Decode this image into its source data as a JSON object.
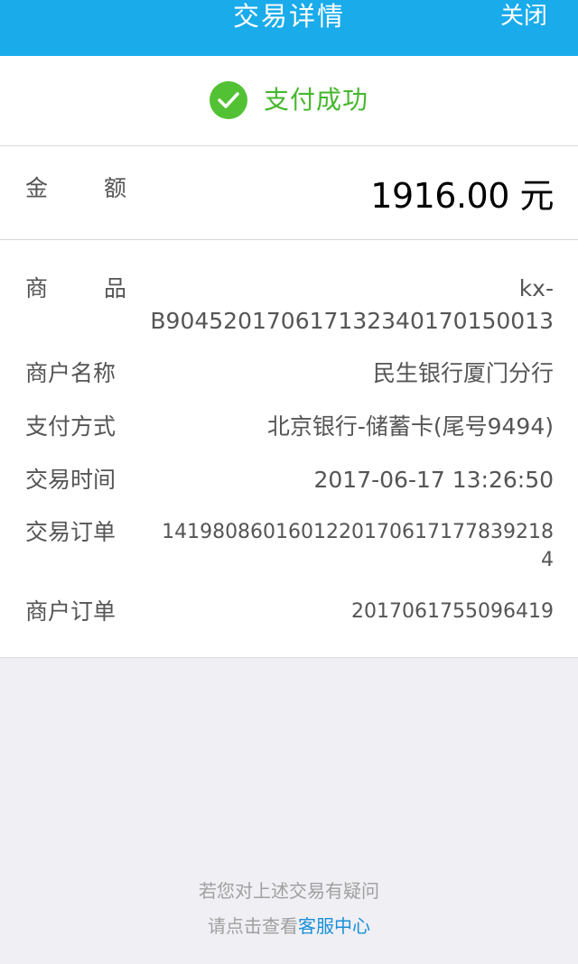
{
  "header": {
    "title": "交易详情",
    "close_label": "关闭",
    "background_color": "#1aabeb"
  },
  "status": {
    "icon": "checkmark-circle-icon",
    "text": "支付成功",
    "color": "#46b72d"
  },
  "amount": {
    "label_chars": [
      "金",
      "额"
    ],
    "value": "1916.00 元"
  },
  "details": {
    "product": {
      "label_chars": [
        "商",
        "品"
      ],
      "value_line1": "kx-",
      "value_line2": "B904520170617132340170150013"
    },
    "merchant_name": {
      "label": "商户名称",
      "value": "民生银行厦门分行"
    },
    "payment_method": {
      "label": "支付方式",
      "value": "北京银行-储蓄卡(尾号9494)"
    },
    "transaction_time": {
      "label": "交易时间",
      "value": "2017-06-17 13:26:50"
    },
    "transaction_order": {
      "label": "交易订单",
      "value_line1": "141980860160122017061717783921​8",
      "value_line2": "4"
    },
    "merchant_order": {
      "label": "商户订单",
      "value": "2017061755096419"
    }
  },
  "footer": {
    "line1": "若您对上述交易有疑问",
    "line2_prefix": "请点击查看",
    "link_label": "客服中心",
    "link_color": "#1a90d8"
  }
}
